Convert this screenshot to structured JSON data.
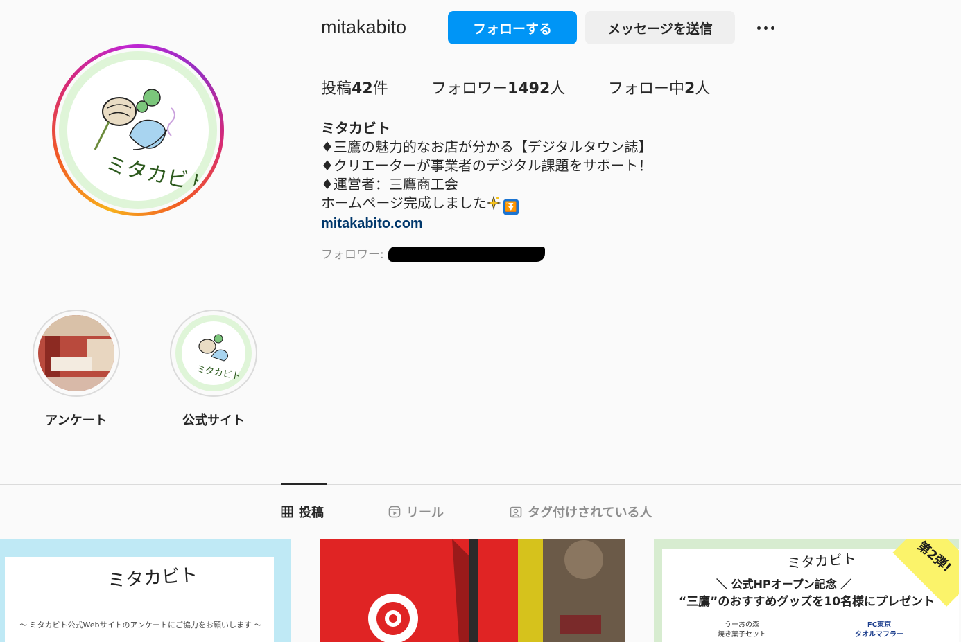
{
  "profile": {
    "username": "mitakabito",
    "follow_label": "フォローする",
    "message_label": "メッセージを送信",
    "stats": {
      "posts_prefix": "投稿",
      "posts_count": "42",
      "posts_suffix": "件",
      "followers_prefix": "フォロワー",
      "followers_count": "1492",
      "followers_suffix": "人",
      "following_prefix": "フォロー中",
      "following_count": "2",
      "following_suffix": "人"
    },
    "bio": {
      "name": "ミタカビト",
      "line1": "♦三鷹の魅力的なお店が分かる【デジタルタウン誌】",
      "line2": "♦クリエーターが事業者のデジタル課題をサポート！",
      "line3": "♦運営者：三鷹商工会",
      "line4": "ホームページ完成しました",
      "link": "mitakabito.com"
    },
    "followed_by_label": "フォロワー:",
    "avatar_logo_text": "ミタカビト"
  },
  "highlights": [
    {
      "label": "アンケート"
    },
    {
      "label": "公式サイト",
      "logo_text": "ミタカビト"
    }
  ],
  "tabs": {
    "posts": "投稿",
    "reels": "リール",
    "tagged": "タグ付けされている人"
  },
  "posts": {
    "post1": {
      "logo": "ミタカビト",
      "caption": "〜 ミタカビト公式Webサイトのアンケートにご協力をお願いします 〜"
    },
    "post3": {
      "logo": "ミタカビト",
      "headline1": "＼ 公式HPオープン記念 ／",
      "headline2": "“三鷹”のおすすめグッズを10名様にプレゼント",
      "item1_line1": "うーおの森",
      "item1_line2": "焼き菓子セット",
      "item2_line1": "FC東京",
      "item2_line2": "タオルマフラー",
      "badge": "第2弾!"
    }
  },
  "colors": {
    "primary": "#0095f6",
    "link": "#00376b",
    "muted": "#8e8e8e"
  }
}
